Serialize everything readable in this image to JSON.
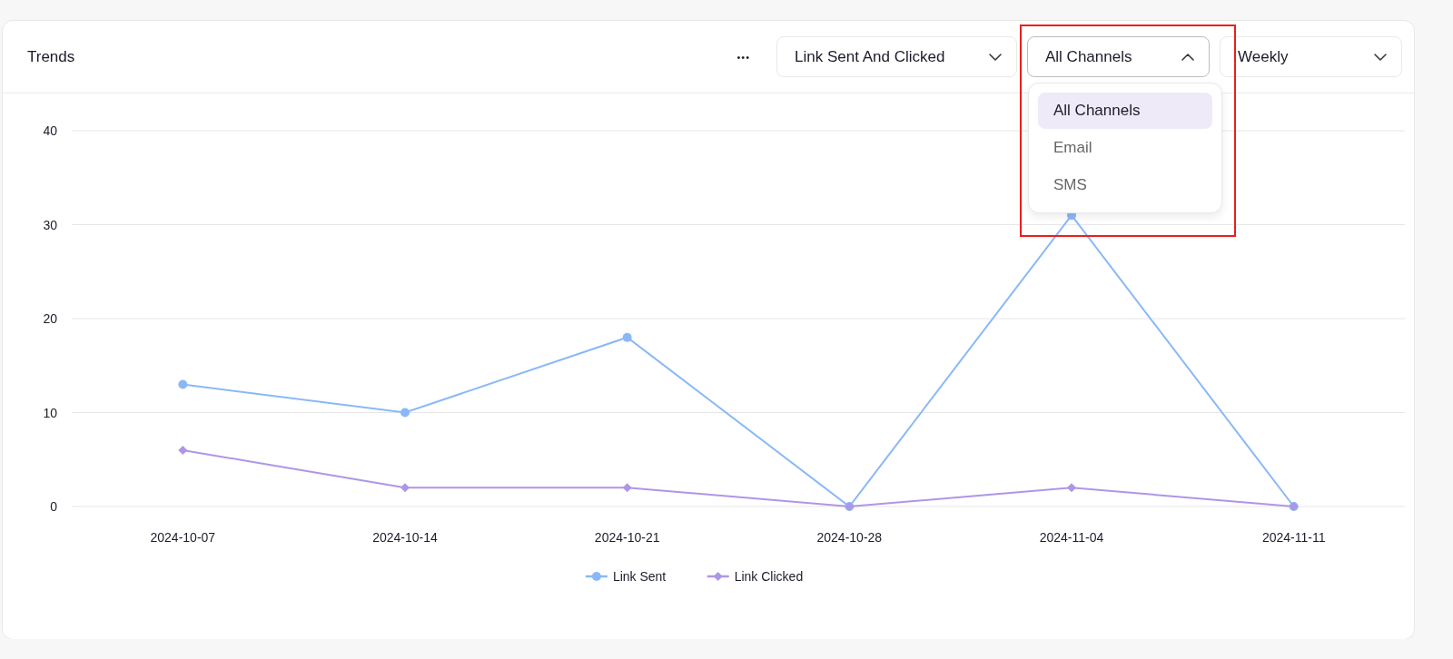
{
  "card": {
    "title": "Trends"
  },
  "toolbar": {
    "more_button": "•••",
    "dropdowns": [
      {
        "value": "Link Sent And Clicked",
        "expanded": false
      },
      {
        "value": "All Channels",
        "expanded": true
      },
      {
        "value": "Weekly",
        "expanded": false
      }
    ]
  },
  "channel_menu": {
    "items": [
      {
        "label": "All Channels",
        "selected": true
      },
      {
        "label": "Email",
        "selected": false
      },
      {
        "label": "SMS",
        "selected": false
      }
    ]
  },
  "chart": {
    "chart_data": {
      "type": "line",
      "categories": [
        "2024-10-07",
        "2024-10-14",
        "2024-10-21",
        "2024-10-28",
        "2024-11-04",
        "2024-11-11"
      ],
      "ylim": [
        0,
        40
      ],
      "grid": true,
      "legend": true,
      "yticks": [
        0,
        10,
        20,
        30,
        40
      ],
      "series": [
        {
          "name": "Link Sent",
          "color": "#8ab8f7",
          "marker": "circle",
          "values": [
            13,
            10,
            18,
            0,
            31,
            0
          ]
        },
        {
          "name": "Link Clicked",
          "color": "#ae96e6",
          "marker": "diamond",
          "values": [
            6,
            2,
            2,
            0,
            2,
            0
          ]
        }
      ]
    }
  }
}
